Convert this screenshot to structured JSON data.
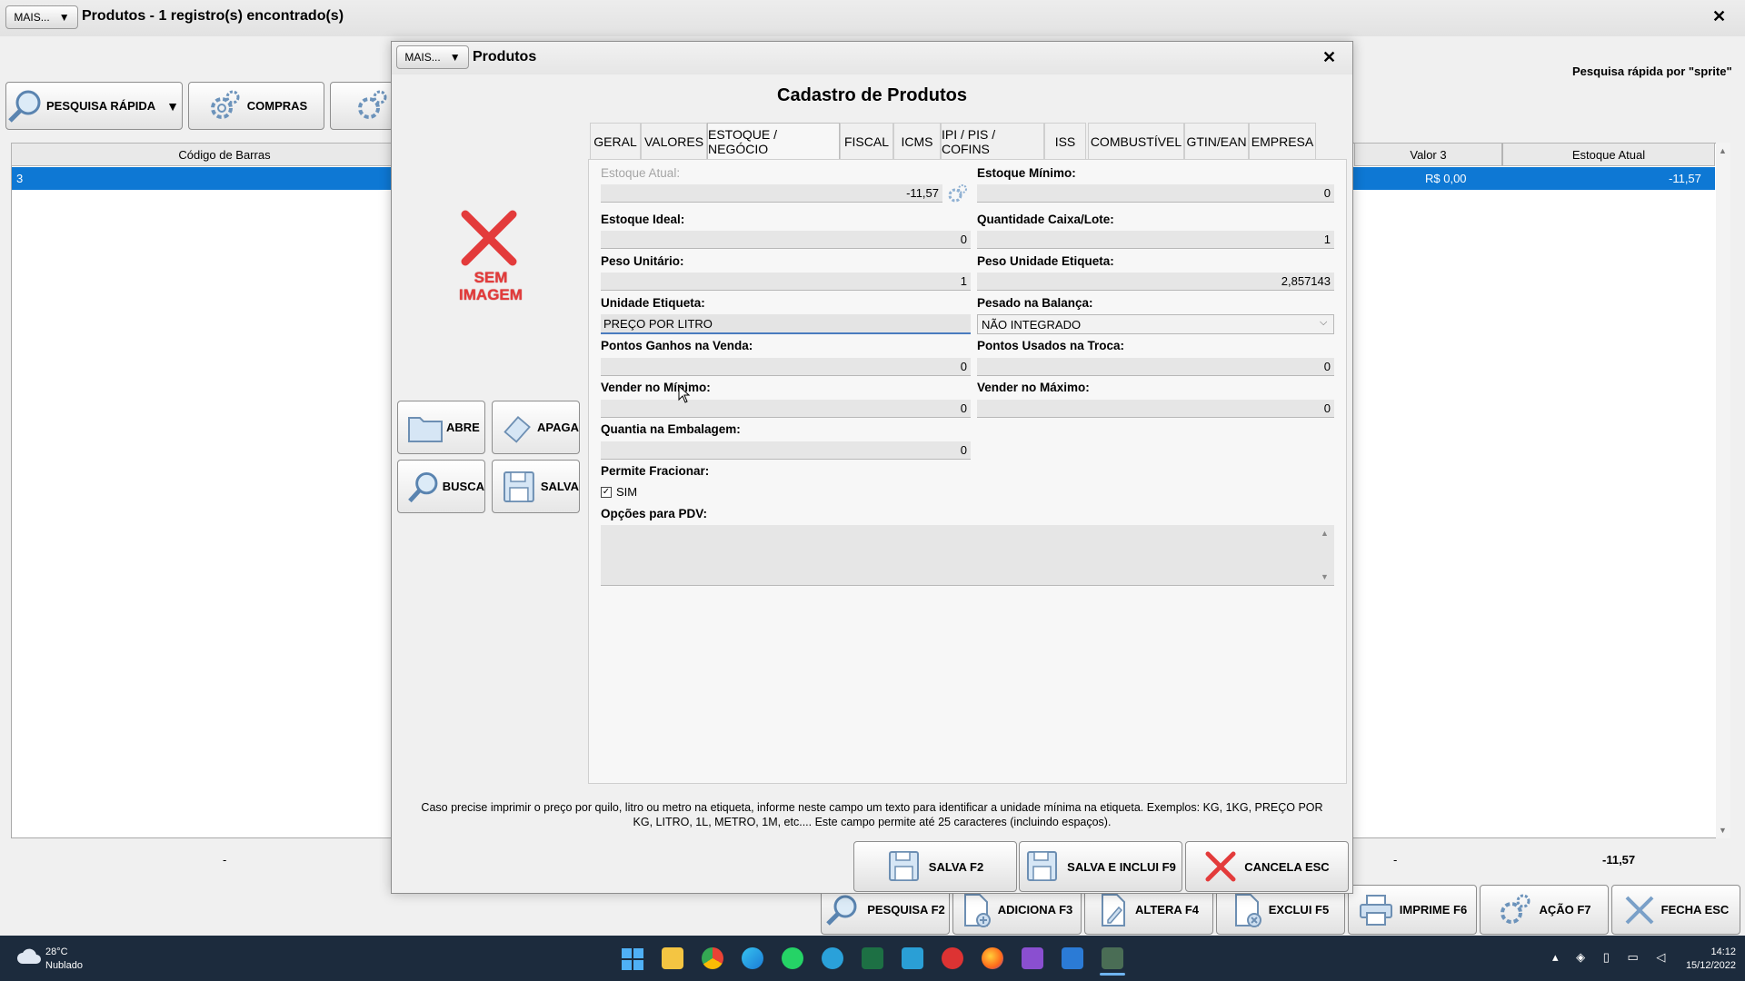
{
  "background_window": {
    "mais_label": "MAIS...",
    "title": "Produtos - 1 registro(s) encontrado(s)",
    "close_glyph": "✕",
    "quick_search_hint": "Pesquisa rápida por \"sprite\"",
    "toolbar": {
      "pesquisa_rapida": "PESQUISA RÁPIDA",
      "compras": "COMPRAS"
    },
    "grid": {
      "columns": [
        "Código de Barras",
        "Valor 3",
        "Estoque Atual"
      ],
      "row": {
        "codigo": "3",
        "valor3": "R$ 0,00",
        "estoque": "-11,57"
      }
    },
    "summary": {
      "left": "-",
      "mid": "-",
      "right": "-11,57"
    },
    "bottom_buttons": {
      "pesquisa": "PESQUISA F2",
      "adiciona": "ADICIONA F3",
      "altera": "ALTERA F4",
      "exclui": "EXCLUI F5",
      "imprime": "IMPRIME F6",
      "acao": "AÇÃO F7",
      "fecha": "FECHA ESC"
    }
  },
  "dialog": {
    "mais_label": "MAIS...",
    "title": "Produtos",
    "close_glyph": "✕",
    "heading": "Cadastro de Produtos",
    "image_placeholder": {
      "line1": "SEM",
      "line2": "IMAGEM"
    },
    "side_buttons": {
      "abre": "ABRE",
      "apaga": "APAGA",
      "busca": "BUSCA",
      "salva": "SALVA"
    },
    "tabs": [
      "GERAL",
      "VALORES",
      "ESTOQUE / NEGÓCIO",
      "FISCAL",
      "ICMS",
      "IPI / PIS / COFINS",
      "ISS",
      "COMBUSTÍVEL",
      "GTIN/EAN",
      "EMPRESA"
    ],
    "active_tab": "ESTOQUE / NEGÓCIO",
    "fields": {
      "estoque_atual": {
        "label": "Estoque Atual:",
        "value": "-11,57"
      },
      "estoque_minimo": {
        "label": "Estoque Mínimo:",
        "value": "0"
      },
      "estoque_ideal": {
        "label": "Estoque Ideal:",
        "value": "0"
      },
      "quantidade_caixa": {
        "label": "Quantidade Caixa/Lote:",
        "value": "1"
      },
      "peso_unitario": {
        "label": "Peso Unitário:",
        "value": "1"
      },
      "peso_unidade_etiqueta": {
        "label": "Peso Unidade Etiqueta:",
        "value": "2,857143"
      },
      "unidade_etiqueta": {
        "label": "Unidade Etiqueta:",
        "value": "PREÇO POR LITRO"
      },
      "pesado_balanca": {
        "label": "Pesado na Balança:",
        "value": "NÃO INTEGRADO"
      },
      "pontos_ganhos": {
        "label": "Pontos Ganhos na Venda:",
        "value": "0"
      },
      "pontos_usados": {
        "label": "Pontos Usados na Troca:",
        "value": "0"
      },
      "vender_minimo": {
        "label": "Vender no Mínimo:",
        "value": "0"
      },
      "vender_maximo": {
        "label": "Vender no Máximo:",
        "value": "0"
      },
      "quantia_embalagem": {
        "label": "Quantia na Embalagem:",
        "value": "0"
      },
      "permite_fracionar": {
        "label": "Permite Fracionar:",
        "checkbox_label": "SIM",
        "checked": true
      },
      "opcoes_pdv": {
        "label": "Opções para PDV:",
        "value": ""
      }
    },
    "hint_line1": "Caso precise imprimir o preço por quilo, litro ou metro na etiqueta, informe neste campo um texto para identificar a unidade mínima na etiqueta. Exemplos: KG, 1KG, PREÇO POR",
    "hint_line2": "KG, LITRO, 1L, METRO, 1M, etc.... Este campo permite até 25 caracteres (incluindo espaços).",
    "footer_buttons": {
      "salva": "SALVA F2",
      "salva_inclui": "SALVA E INCLUI F9",
      "cancela": "CANCELA ESC"
    }
  },
  "taskbar": {
    "weather_temp": "28°C",
    "weather_desc": "Nublado",
    "time": "14:12",
    "date": "15/12/2022"
  }
}
